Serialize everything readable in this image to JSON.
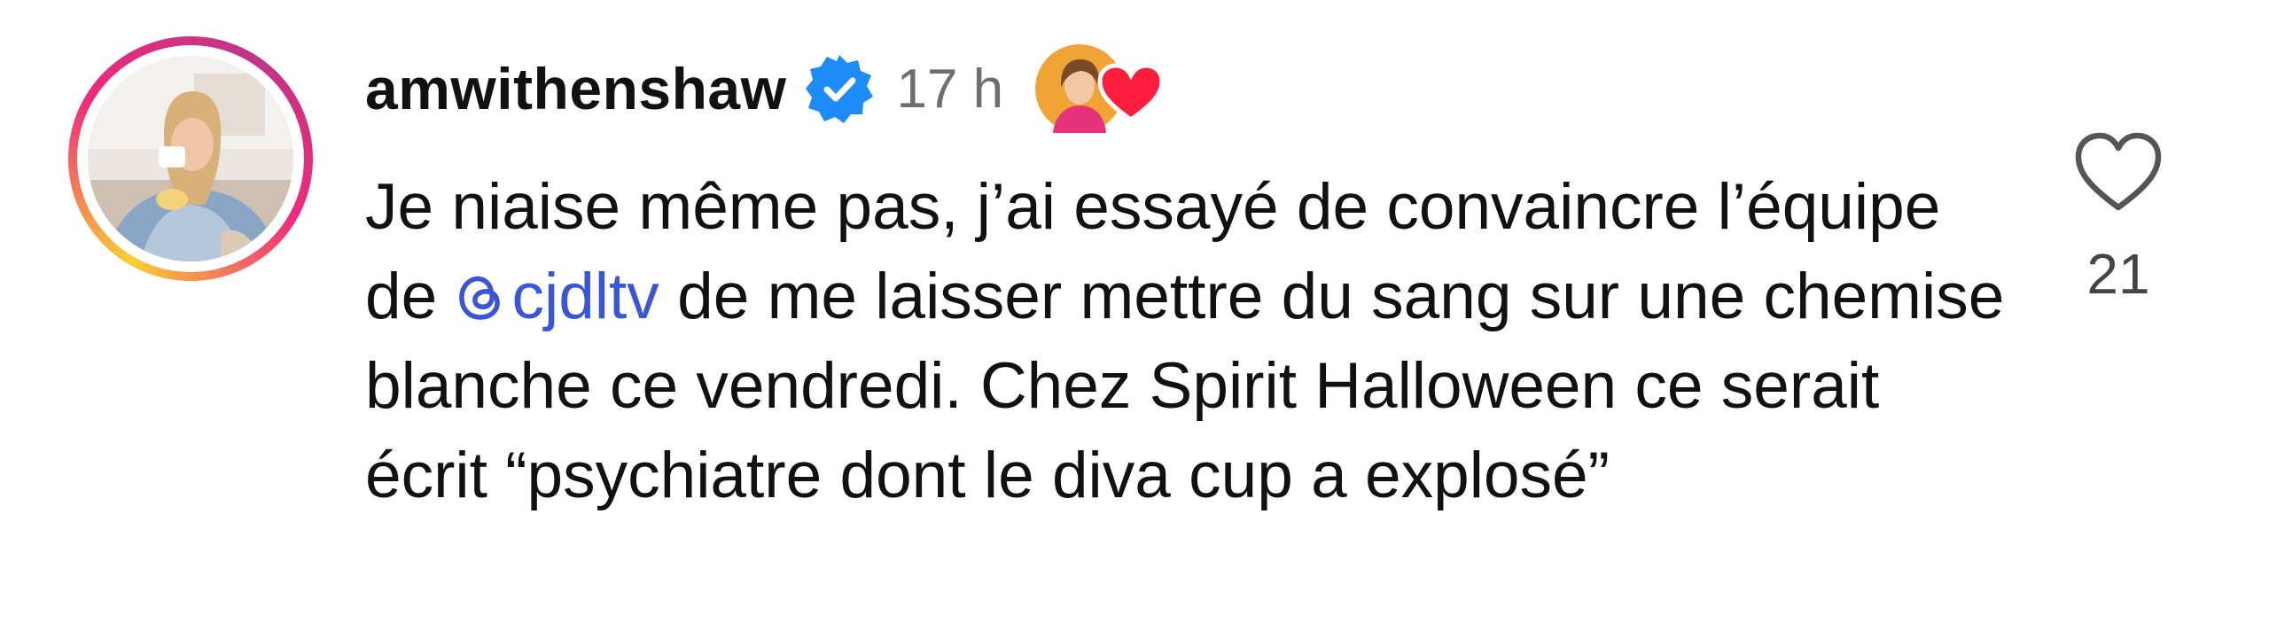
{
  "comment": {
    "username": "amwithenshaw",
    "verified": true,
    "timestamp": "17 h",
    "reaction_icon": "heart-icon",
    "body": {
      "text_before_mention": "Je niaise même pas, j’ai essayé de convaincre l’équipe de ",
      "mention_icon": "threads-icon",
      "mention": "cjdltv",
      "text_after_mention": " de me laisser mettre du sang sur une chemise blanche ce vendredi. Chez Spirit Halloween ce serait écrit “psychiatre dont le diva cup a explosé”"
    },
    "like_icon": "heart-outline-icon",
    "like_count": "21"
  },
  "colors": {
    "mention": "#3a55d6",
    "verified_badge": "#1d8cf8",
    "reaction_heart": "#ff1f3d",
    "timestamp": "#6e6e6e",
    "avatar_ring_start": "#f9ce34",
    "avatar_ring_end": "#c13584"
  }
}
